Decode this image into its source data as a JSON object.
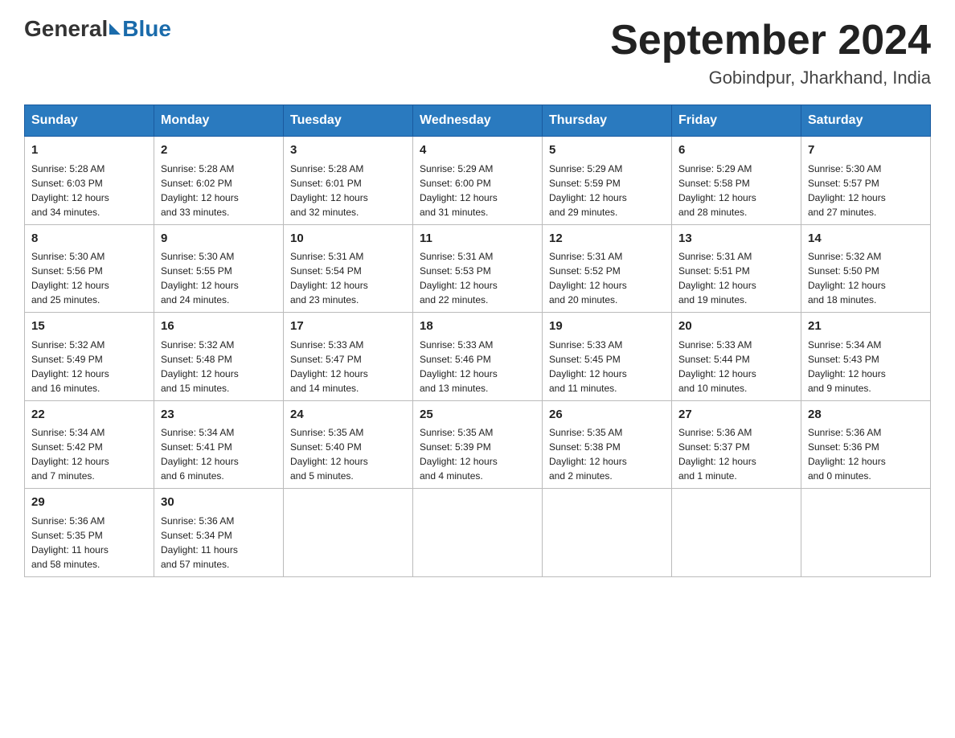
{
  "header": {
    "logo_general": "General",
    "logo_blue": "Blue",
    "month_title": "September 2024",
    "location": "Gobindpur, Jharkhand, India"
  },
  "days_of_week": [
    "Sunday",
    "Monday",
    "Tuesday",
    "Wednesday",
    "Thursday",
    "Friday",
    "Saturday"
  ],
  "weeks": [
    [
      {
        "day": "1",
        "info": "Sunrise: 5:28 AM\nSunset: 6:03 PM\nDaylight: 12 hours\nand 34 minutes."
      },
      {
        "day": "2",
        "info": "Sunrise: 5:28 AM\nSunset: 6:02 PM\nDaylight: 12 hours\nand 33 minutes."
      },
      {
        "day": "3",
        "info": "Sunrise: 5:28 AM\nSunset: 6:01 PM\nDaylight: 12 hours\nand 32 minutes."
      },
      {
        "day": "4",
        "info": "Sunrise: 5:29 AM\nSunset: 6:00 PM\nDaylight: 12 hours\nand 31 minutes."
      },
      {
        "day": "5",
        "info": "Sunrise: 5:29 AM\nSunset: 5:59 PM\nDaylight: 12 hours\nand 29 minutes."
      },
      {
        "day": "6",
        "info": "Sunrise: 5:29 AM\nSunset: 5:58 PM\nDaylight: 12 hours\nand 28 minutes."
      },
      {
        "day": "7",
        "info": "Sunrise: 5:30 AM\nSunset: 5:57 PM\nDaylight: 12 hours\nand 27 minutes."
      }
    ],
    [
      {
        "day": "8",
        "info": "Sunrise: 5:30 AM\nSunset: 5:56 PM\nDaylight: 12 hours\nand 25 minutes."
      },
      {
        "day": "9",
        "info": "Sunrise: 5:30 AM\nSunset: 5:55 PM\nDaylight: 12 hours\nand 24 minutes."
      },
      {
        "day": "10",
        "info": "Sunrise: 5:31 AM\nSunset: 5:54 PM\nDaylight: 12 hours\nand 23 minutes."
      },
      {
        "day": "11",
        "info": "Sunrise: 5:31 AM\nSunset: 5:53 PM\nDaylight: 12 hours\nand 22 minutes."
      },
      {
        "day": "12",
        "info": "Sunrise: 5:31 AM\nSunset: 5:52 PM\nDaylight: 12 hours\nand 20 minutes."
      },
      {
        "day": "13",
        "info": "Sunrise: 5:31 AM\nSunset: 5:51 PM\nDaylight: 12 hours\nand 19 minutes."
      },
      {
        "day": "14",
        "info": "Sunrise: 5:32 AM\nSunset: 5:50 PM\nDaylight: 12 hours\nand 18 minutes."
      }
    ],
    [
      {
        "day": "15",
        "info": "Sunrise: 5:32 AM\nSunset: 5:49 PM\nDaylight: 12 hours\nand 16 minutes."
      },
      {
        "day": "16",
        "info": "Sunrise: 5:32 AM\nSunset: 5:48 PM\nDaylight: 12 hours\nand 15 minutes."
      },
      {
        "day": "17",
        "info": "Sunrise: 5:33 AM\nSunset: 5:47 PM\nDaylight: 12 hours\nand 14 minutes."
      },
      {
        "day": "18",
        "info": "Sunrise: 5:33 AM\nSunset: 5:46 PM\nDaylight: 12 hours\nand 13 minutes."
      },
      {
        "day": "19",
        "info": "Sunrise: 5:33 AM\nSunset: 5:45 PM\nDaylight: 12 hours\nand 11 minutes."
      },
      {
        "day": "20",
        "info": "Sunrise: 5:33 AM\nSunset: 5:44 PM\nDaylight: 12 hours\nand 10 minutes."
      },
      {
        "day": "21",
        "info": "Sunrise: 5:34 AM\nSunset: 5:43 PM\nDaylight: 12 hours\nand 9 minutes."
      }
    ],
    [
      {
        "day": "22",
        "info": "Sunrise: 5:34 AM\nSunset: 5:42 PM\nDaylight: 12 hours\nand 7 minutes."
      },
      {
        "day": "23",
        "info": "Sunrise: 5:34 AM\nSunset: 5:41 PM\nDaylight: 12 hours\nand 6 minutes."
      },
      {
        "day": "24",
        "info": "Sunrise: 5:35 AM\nSunset: 5:40 PM\nDaylight: 12 hours\nand 5 minutes."
      },
      {
        "day": "25",
        "info": "Sunrise: 5:35 AM\nSunset: 5:39 PM\nDaylight: 12 hours\nand 4 minutes."
      },
      {
        "day": "26",
        "info": "Sunrise: 5:35 AM\nSunset: 5:38 PM\nDaylight: 12 hours\nand 2 minutes."
      },
      {
        "day": "27",
        "info": "Sunrise: 5:36 AM\nSunset: 5:37 PM\nDaylight: 12 hours\nand 1 minute."
      },
      {
        "day": "28",
        "info": "Sunrise: 5:36 AM\nSunset: 5:36 PM\nDaylight: 12 hours\nand 0 minutes."
      }
    ],
    [
      {
        "day": "29",
        "info": "Sunrise: 5:36 AM\nSunset: 5:35 PM\nDaylight: 11 hours\nand 58 minutes."
      },
      {
        "day": "30",
        "info": "Sunrise: 5:36 AM\nSunset: 5:34 PM\nDaylight: 11 hours\nand 57 minutes."
      },
      {
        "day": "",
        "info": ""
      },
      {
        "day": "",
        "info": ""
      },
      {
        "day": "",
        "info": ""
      },
      {
        "day": "",
        "info": ""
      },
      {
        "day": "",
        "info": ""
      }
    ]
  ]
}
